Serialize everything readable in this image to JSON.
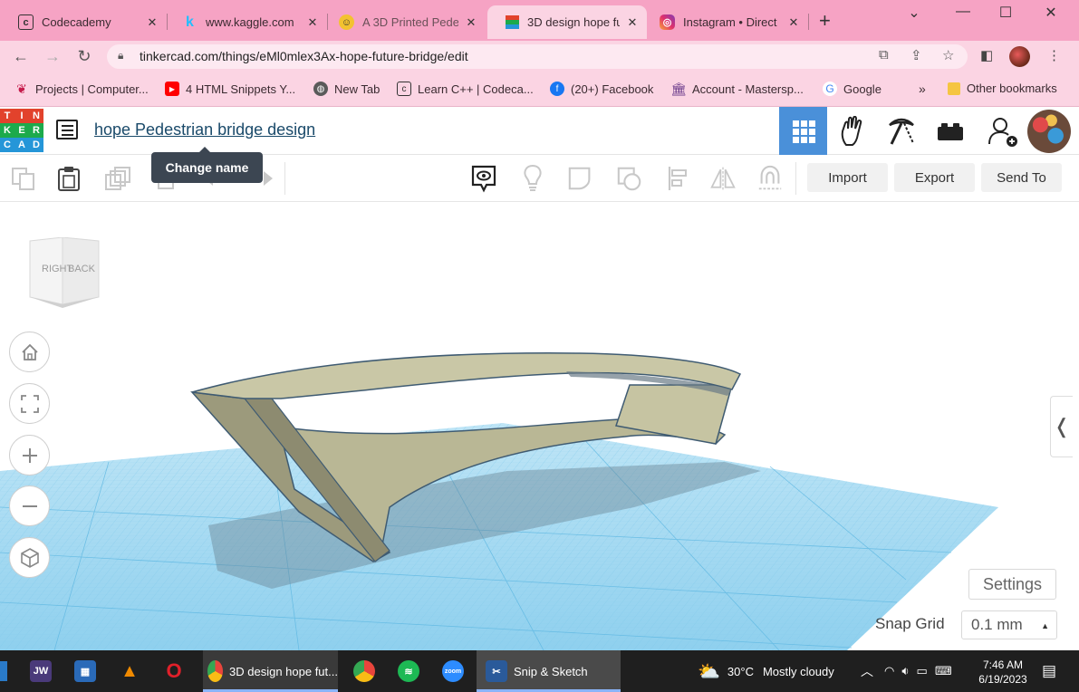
{
  "browser": {
    "tabs": [
      {
        "title": "Codecademy",
        "icon": "codecademy-icon",
        "active": false
      },
      {
        "title": "www.kaggle.com",
        "icon": "kaggle-icon",
        "active": false
      },
      {
        "title": "A 3D Printed Pede",
        "icon": "printer-person-icon",
        "active": false
      },
      {
        "title": "3D design hope fu",
        "icon": "tinkercad-icon",
        "active": true
      },
      {
        "title": "Instagram • Direct",
        "icon": "instagram-icon",
        "active": false
      }
    ],
    "url": "tinkercad.com/things/eMl0mlex3Ax-hope-future-bridge/edit",
    "bookmarks": [
      {
        "label": "Projects | Computer...",
        "icon": "raspberry-pi-icon"
      },
      {
        "label": "4 HTML Snippets Y...",
        "icon": "youtube-icon"
      },
      {
        "label": "New Tab",
        "icon": "globe-icon"
      },
      {
        "label": "Learn C++ | Codeca...",
        "icon": "codecademy-icon"
      },
      {
        "label": "(20+) Facebook",
        "icon": "facebook-icon"
      },
      {
        "label": "Account - Mastersp...",
        "icon": "bank-icon"
      },
      {
        "label": "Google",
        "icon": "google-icon"
      }
    ],
    "more_bookmarks": "»",
    "other_bookmarks": "Other bookmarks"
  },
  "app": {
    "logo_letters": [
      "T",
      "I",
      "N",
      "K",
      "E",
      "R",
      "C",
      "A",
      "D"
    ],
    "logo_colors": [
      "#e2422c",
      "#e2422c",
      "#e2422c",
      "#1caa4c",
      "#1caa4c",
      "#1caa4c",
      "#2596d8",
      "#2596d8",
      "#2596d8"
    ],
    "design_title": "hope Pedestrian bridge design",
    "tooltip": "Change name",
    "header_tabs": [
      "grid-view-icon",
      "hand-icon",
      "pickaxe-icon",
      "bricks-icon",
      "add-user-icon"
    ],
    "accent": "#4a90d9"
  },
  "toolbar": {
    "import_label": "Import",
    "export_label": "Export",
    "send_to_label": "Send To"
  },
  "viewcube": {
    "right": "RIGHT",
    "back": "BACK"
  },
  "workplane": {
    "settings_label": "Settings",
    "snap_grid_label": "Snap Grid",
    "snap_grid_value": "0.1 mm",
    "grid_color": "#7ec8ea"
  },
  "taskbar": {
    "chrome_window": "3D design hope fut...",
    "snip_window": "Snip & Sketch",
    "weather_temp": "30°C",
    "weather_desc": "Mostly cloudy",
    "time": "7:46 AM",
    "date": "6/19/2023"
  }
}
